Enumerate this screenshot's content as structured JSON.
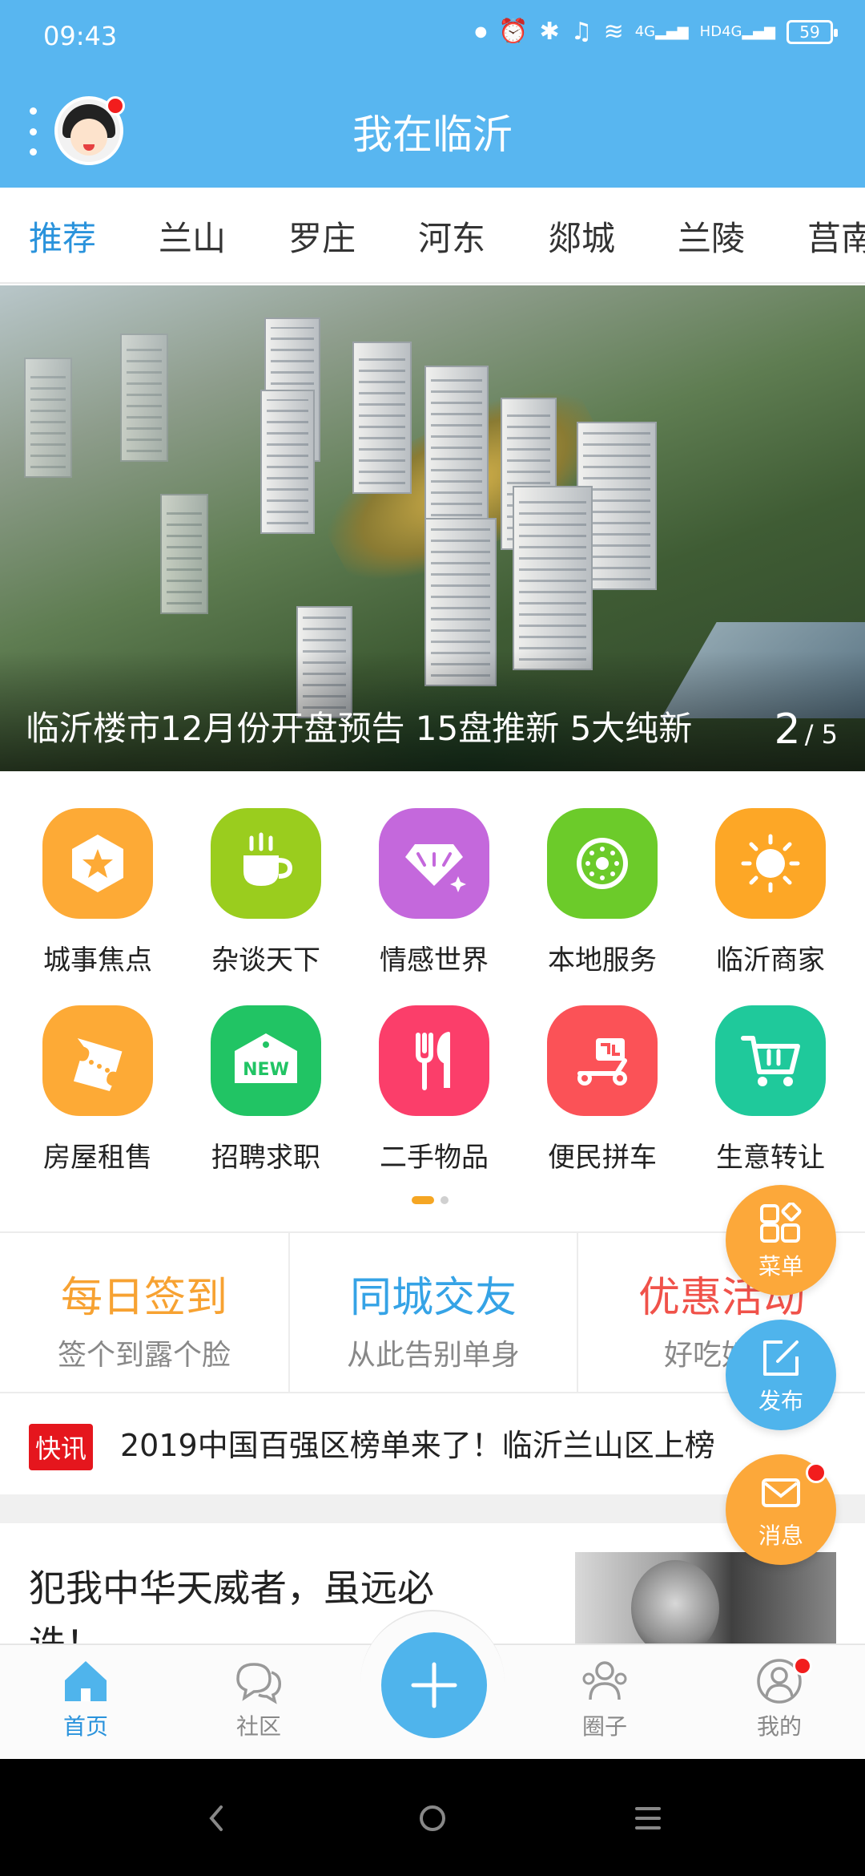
{
  "status_bar": {
    "time": "09:43",
    "battery": "59",
    "net1": "4G",
    "net2": "4G",
    "hd": "HD"
  },
  "header": {
    "title": "我在临沂"
  },
  "tabs": [
    "推荐",
    "兰山",
    "罗庄",
    "河东",
    "郯城",
    "兰陵",
    "莒南"
  ],
  "banner": {
    "caption": "临沂楼市12月份开盘预告 15盘推新 5大纯新",
    "page_current": "2",
    "page_total": "/ 5"
  },
  "categories": [
    {
      "label": "城事焦点",
      "icon": "star-hexagon-icon",
      "color": "#fdaa36"
    },
    {
      "label": "杂谈天下",
      "icon": "coffee-cup-icon",
      "color": "#9acd1e"
    },
    {
      "label": "情感世界",
      "icon": "diamond-icon",
      "color": "#c468dc"
    },
    {
      "label": "本地服务",
      "icon": "kiwi-icon",
      "color": "#6ccb2a"
    },
    {
      "label": "临沂商家",
      "icon": "sun-icon",
      "color": "#fda726"
    },
    {
      "label": "房屋租售",
      "icon": "ticket-icon",
      "color": "#fdaa36"
    },
    {
      "label": "招聘求职",
      "icon": "new-tag-icon",
      "color": "#21c464"
    },
    {
      "label": "二手物品",
      "icon": "fork-knife-icon",
      "color": "#fb3e6a"
    },
    {
      "label": "便民拼车",
      "icon": "scooter-icon",
      "color": "#fb5257"
    },
    {
      "label": "生意转让",
      "icon": "cart-icon",
      "color": "#1fc99b"
    }
  ],
  "promos": [
    {
      "title": "每日签到",
      "sub": "签个到露个脸",
      "color": "#f7a232"
    },
    {
      "title": "同城交友",
      "sub": "从此告别单身",
      "color": "#35a3e6"
    },
    {
      "title": "优惠活动",
      "sub": "好吃好玩",
      "color": "#f0524a"
    }
  ],
  "news": {
    "tag": "快讯",
    "text": "2019中国百强区榜单来了！临沂兰山区上榜"
  },
  "article": {
    "title": "犯我中华天威者，虽远必诛！"
  },
  "fabs": {
    "menu": "菜单",
    "post": "发布",
    "message": "消息"
  },
  "bottom_nav": {
    "home": "首页",
    "community": "社区",
    "circle": "圈子",
    "mine": "我的"
  }
}
